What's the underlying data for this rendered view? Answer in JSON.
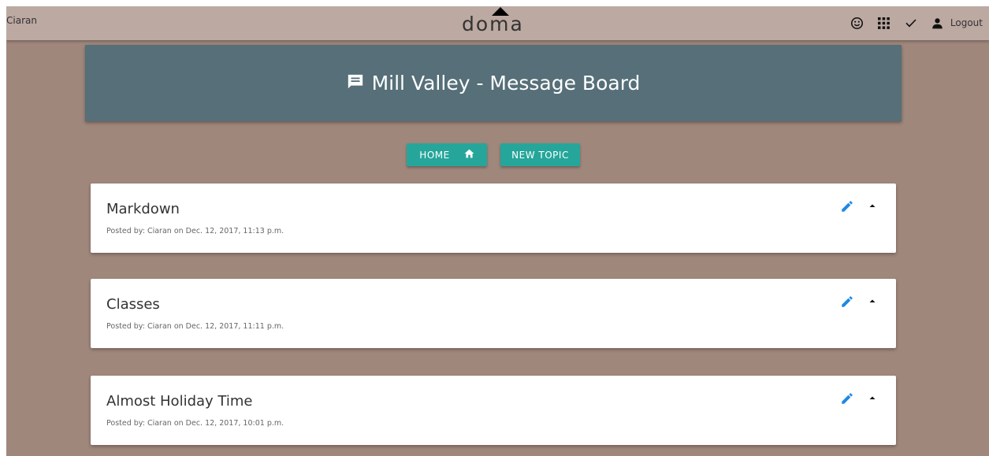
{
  "navbar": {
    "username": "Ciaran",
    "logo_text": "doma",
    "icons": [
      "smiley-icon",
      "apps-grid-icon",
      "check-icon",
      "person-icon"
    ],
    "logout_label": "Logout"
  },
  "banner": {
    "icon": "message-icon",
    "title": "Mill Valley - Message Board"
  },
  "actions": {
    "home_label": "HOME",
    "new_topic_label": "NEW TOPIC"
  },
  "colors": {
    "background": "#a0877c",
    "navbar": "#bca9a2",
    "banner": "#566f79",
    "button": "#26a69a",
    "edit_icon": "#1e88e5"
  },
  "topics": [
    {
      "title": "Markdown",
      "posted": "Posted by: Ciaran on Dec. 12, 2017, 11:13 p.m."
    },
    {
      "title": "Classes",
      "posted": "Posted by: Ciaran on Dec. 12, 2017, 11:11 p.m."
    },
    {
      "title": "Almost Holiday Time",
      "posted": "Posted by: Ciaran on Dec. 12, 2017, 10:01 p.m."
    }
  ]
}
